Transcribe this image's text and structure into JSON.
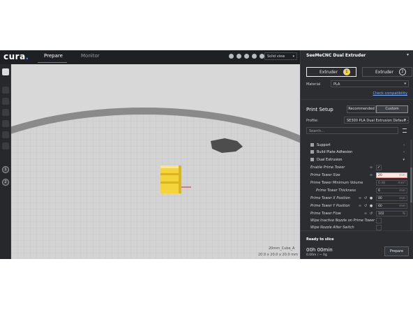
{
  "app": {
    "logo": "cura",
    "tabs": [
      {
        "label": "Prepare",
        "active": true
      },
      {
        "label": "Monitor",
        "active": false
      }
    ],
    "view_mode": "Solid view"
  },
  "viewport": {
    "object_name": "20mm_Cube_A",
    "object_dims": "20.0 x 20.0 x 20.0 mm"
  },
  "printer": {
    "name": "SeeMeCNC Dual Extruder",
    "extruders": [
      {
        "label": "Extruder",
        "number": "1"
      },
      {
        "label": "Extruder",
        "number": "2"
      }
    ],
    "material_label": "Material",
    "material_value": "PLA",
    "compat_link": "Check compatibility"
  },
  "print_setup": {
    "title": "Print Setup",
    "modes": [
      "Recommended",
      "Custom"
    ],
    "profile_label": "Profile:",
    "profile_value": "SE300 PLA Dual Extrusion Default -",
    "search_placeholder": "Search...",
    "categories": [
      {
        "label": "Support"
      },
      {
        "label": "Build Plate Adhesion"
      },
      {
        "label": "Dual Extrusion"
      }
    ],
    "settings": [
      {
        "label": "Enable Prime Tower",
        "type": "check",
        "checked": true
      },
      {
        "label": "Prime Tower Size",
        "value": "20",
        "unit": "mm",
        "state": "error"
      },
      {
        "label": "Prime Tower Minimum Volume",
        "value": "0.48",
        "unit": "mm³",
        "state": "dim"
      },
      {
        "label": "Prime Tower Thickness",
        "value": "6",
        "unit": "mm"
      },
      {
        "label": "Prime Tower X Position",
        "value": "80",
        "unit": "mm"
      },
      {
        "label": "Prime Tower Y Position",
        "value": "60",
        "unit": "mm"
      },
      {
        "label": "Prime Tower Flow",
        "value": "102",
        "unit": "%"
      },
      {
        "label": "Wipe Inactive Nozzle on Prime Tower",
        "type": "check",
        "checked": false
      },
      {
        "label": "Wipe Nozzle After Switch",
        "type": "check",
        "checked": false
      }
    ]
  },
  "slice": {
    "status": "Ready to slice",
    "time": "00h 00min",
    "usage": "0.00m / ~ 0g",
    "button": "Prepare"
  },
  "colors": {
    "accent": "#3282ff",
    "model": "#f5d33a",
    "panel_bg": "#2b2d31"
  }
}
